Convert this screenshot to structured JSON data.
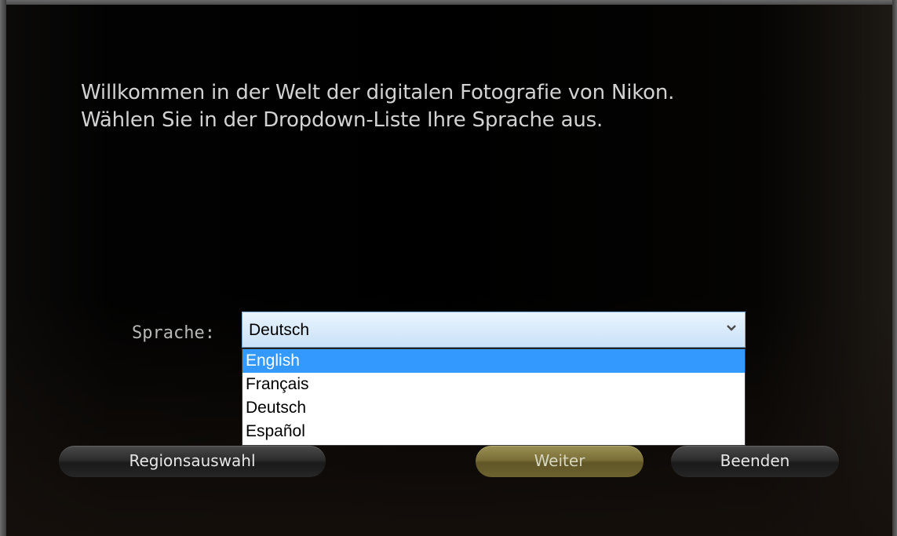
{
  "welcome": {
    "line1": "Willkommen in der Welt der digitalen Fotografie von Nikon.",
    "line2": "Wählen Sie in der Dropdown-Liste Ihre Sprache aus."
  },
  "language": {
    "label": "Sprache:",
    "selected": "Deutsch",
    "options": [
      "English",
      "Français",
      "Deutsch",
      "Español"
    ],
    "highlighted": "English"
  },
  "buttons": {
    "region": "Regionsauswahl",
    "next": "Weiter",
    "exit": "Beenden"
  },
  "icons": {
    "dropdown": "chevron-down-icon"
  },
  "colors": {
    "highlight": "#3399ff",
    "next_button": "#7a6f38"
  }
}
